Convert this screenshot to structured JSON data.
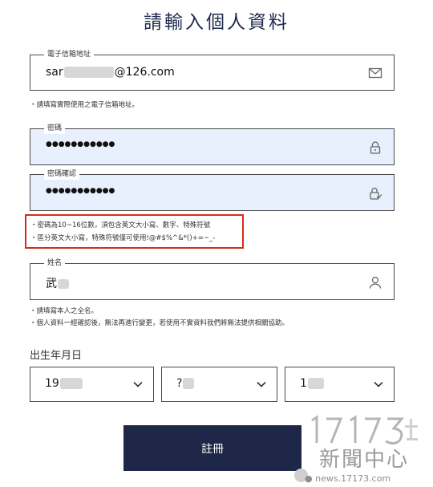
{
  "page": {
    "title": "請輸入個人資料"
  },
  "email": {
    "label": "電子信箱地址",
    "value_start": "sar",
    "value_end": "@126.com",
    "icon": "mail-icon",
    "hint": "・請填寫實際使用之電子信箱地址。"
  },
  "password": {
    "label": "密碼",
    "value": "●●●●●●●●●●●",
    "icon": "lock-icon"
  },
  "password_confirm": {
    "label": "密碼確認",
    "value": "●●●●●●●●●●●",
    "icon": "lock-check-icon"
  },
  "password_rules": [
    "・密碼為10~16位數，須包含英文大小寫、數字、特殊符號",
    "・區分英文大小寫，特殊符號僅可使用!@#$%^&*()+=~_-"
  ],
  "name": {
    "label": "姓名",
    "value": "武",
    "icon": "user-icon",
    "hints": [
      "・請填寫本人之全名。",
      "・個人資料一經確認後，無法再進行變更，若使用不實資料我們將無法提供相關協助。"
    ]
  },
  "birthdate": {
    "label": "出生年月日",
    "year": "19",
    "month": "?",
    "day": "1"
  },
  "submit": {
    "label": "註冊"
  },
  "watermark": {
    "brand": "17173",
    "text": "新聞中心",
    "url": "news.17173.com"
  }
}
